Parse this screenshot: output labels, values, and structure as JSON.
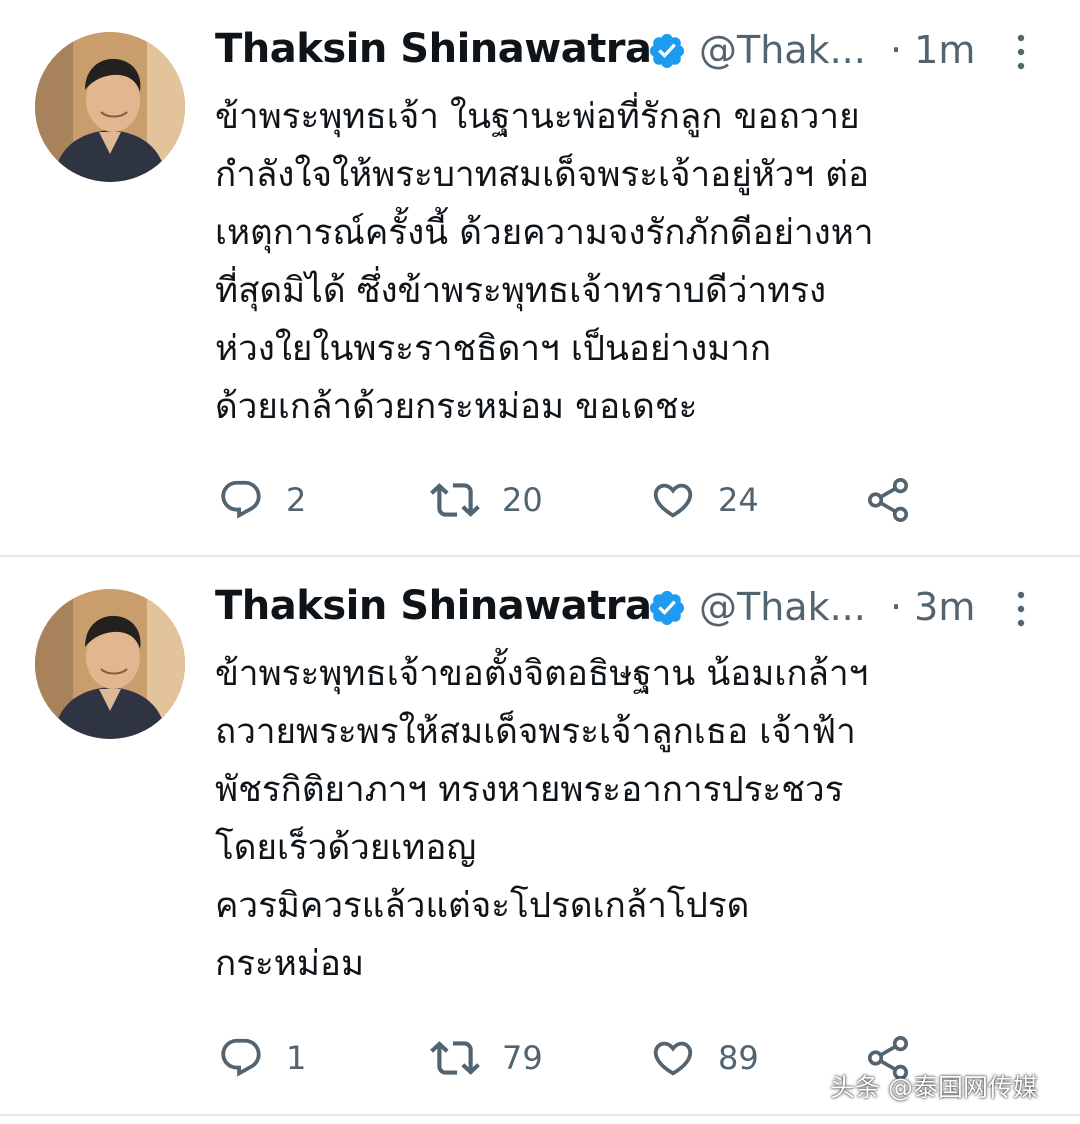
{
  "colors": {
    "text_primary": "#0f1419",
    "text_secondary": "#536471",
    "verified_blue": "#1d9bf0",
    "divider": "#e6e9eb"
  },
  "tweets": [
    {
      "display_name": "Thaksin Shinawatra",
      "handle": "@Thak...",
      "time": "· 1m",
      "lines": [
        "ข้าพระพุทธเจ้า ในฐานะพ่อที่รักลูก ขอถวาย",
        "กำลังใจให้พระบาทสมเด็จพระเจ้าอยู่หัวฯ ต่อ",
        "เหตุการณ์ครั้งนี้ ด้วยความจงรักภักดีอย่างหา",
        "ที่สุดมิได้ ซึ่งข้าพระพุทธเจ้าทราบดีว่าทรง",
        "ห่วงใยในพระราชธิดาฯ เป็นอย่างมาก",
        "ด้วยเกล้าด้วยกระหม่อม ขอเดชะ"
      ],
      "replies": "2",
      "retweets": "20",
      "likes": "24",
      "icons": [
        "avatar",
        "verified-badge-icon",
        "more-options-icon",
        "reply-icon",
        "retweet-icon",
        "like-icon",
        "share-icon"
      ]
    },
    {
      "display_name": "Thaksin Shinawatra",
      "handle": "@Thak...",
      "time": "· 3m",
      "lines": [
        "ข้าพระพุทธเจ้าขอตั้งจิตอธิษฐาน น้อมเกล้าฯ",
        "ถวายพระพรให้สมเด็จพระเจ้าลูกเธอ เจ้าฟ้า",
        "พัชรกิติยาภาฯ ทรงหายพระอาการประชวร",
        "โดยเร็วด้วยเทอญ",
        "ควรมิควรแล้วแต่จะโปรดเกล้าโปรด",
        "กระหม่อม"
      ],
      "replies": "1",
      "retweets": "79",
      "likes": "89",
      "icons": [
        "avatar",
        "verified-badge-icon",
        "more-options-icon",
        "reply-icon",
        "retweet-icon",
        "like-icon",
        "share-icon"
      ]
    }
  ],
  "watermark": "头条 @泰国网传媒"
}
